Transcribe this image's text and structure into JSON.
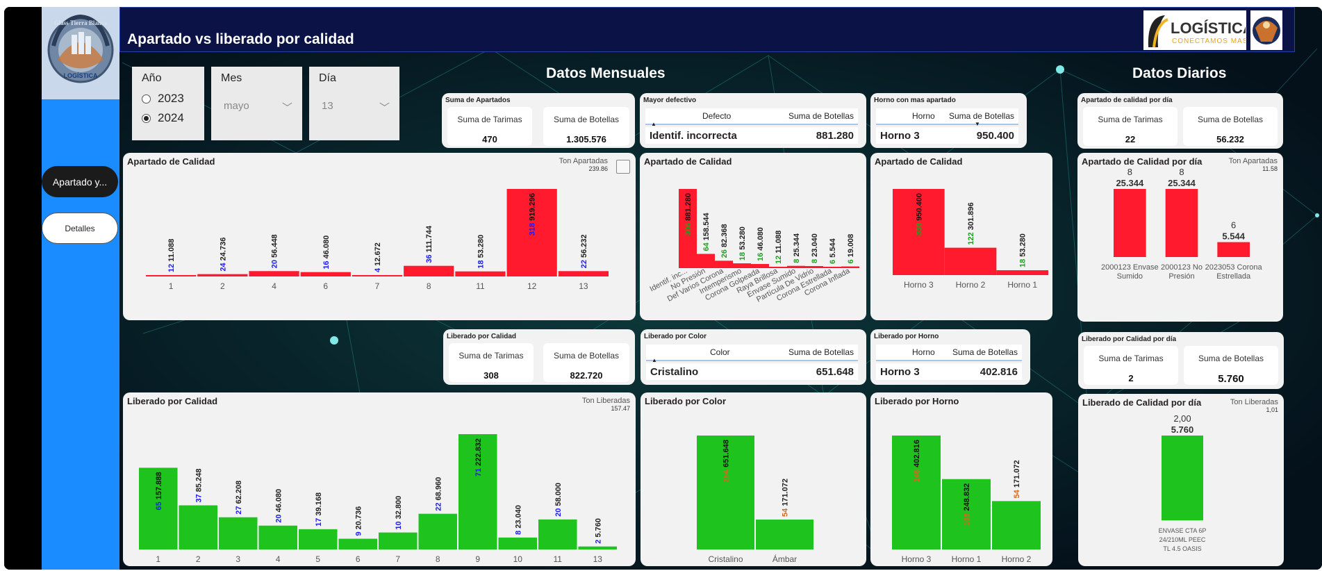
{
  "nav": {
    "logo_text": "Glass Tierra Blanca",
    "logo_sub": "LOGÍSTICA",
    "btn_active": "Apartado y...",
    "btn_detalles": "Detalles"
  },
  "header": {
    "title": "Apartado vs liberado por calidad",
    "logo_main": "LOGÍSTICA",
    "logo_tag": "CONECTAMOS MAS"
  },
  "sections": {
    "monthly": "Datos Mensuales",
    "daily": "Datos Diarios"
  },
  "filters": {
    "year_label": "Año",
    "years": [
      {
        "label": "2023",
        "selected": false
      },
      {
        "label": "2024",
        "selected": true
      }
    ],
    "month_label": "Mes",
    "month_value": "mayo",
    "day_label": "Día",
    "day_value": "13"
  },
  "kpi": {
    "sum_apartados": {
      "title": "Suma de Apartados",
      "l1": "Suma de Tarimas",
      "v1": "470",
      "l2": "Suma de Botellas",
      "v2": "1.305.576"
    },
    "liberado_calidad": {
      "title": "Liberado por Calidad",
      "l1": "Suma de Tarimas",
      "v1": "308",
      "l2": "Suma de Botellas",
      "v2": "822.720"
    },
    "apartado_dia": {
      "title": "Apartado de calidad por día",
      "l1": "Suma de Tarimas",
      "v1": "22",
      "l2": "Suma de Botellas",
      "v2": "56.232"
    },
    "liberado_dia": {
      "title": "Liberado por Calidad por día",
      "l1": "Suma de Tarimas",
      "v1": "2",
      "l2": "Suma de Botellas",
      "v2": "5.760"
    }
  },
  "tables": {
    "mayor_defectivo": {
      "title": "Mayor defectivo",
      "c1": "Defecto",
      "c2": "Suma de Botellas",
      "r1": "Identif. incorrecta",
      "r2": "881.280"
    },
    "horno_apartado": {
      "title": "Horno con mas apartado",
      "c1": "Horno",
      "c2": "Suma de Botellas",
      "r1": "Horno 3",
      "r2": "950.400"
    },
    "liberado_color": {
      "title": "Liberado por Color",
      "c1": "Color",
      "c2": "Suma de Botellas",
      "r1": "Cristalino",
      "r2": "651.648"
    },
    "liberado_horno": {
      "title": "Liberado por Horno",
      "c1": "Horno",
      "c2": "Suma de Botellas",
      "r1": "Horno 3",
      "r2": "402.816"
    }
  },
  "chart_titles": {
    "c1": "Apartado de Calidad",
    "c1_legend": "Ton Apartadas",
    "c1_legend_val": "239.86",
    "c2": "Apartado de Calidad",
    "c3": "Apartado de Calidad",
    "c4": "Apartado de Calidad por día",
    "c4_legend": "Ton Apartadas",
    "c4_legend_val": "11.58",
    "c5": "Liberado por Calidad",
    "c5_legend": "Ton Liberadas",
    "c5_legend_val": "157.47",
    "c6": "Liberado por Color",
    "c7": "Liberado por Horno",
    "c8": "Liberado de Calidad por día",
    "c8_legend": "Ton Liberadas",
    "c8_legend_val": "1,01"
  },
  "chart_data": [
    {
      "id": "apartado_dia_mes",
      "type": "bar",
      "color": "#ff1a2e",
      "categories": [
        "1",
        "2",
        "4",
        "6",
        "7",
        "8",
        "11",
        "12",
        "13"
      ],
      "values": [
        11088,
        24736,
        56448,
        46080,
        12672,
        111744,
        53280,
        919296,
        56232
      ],
      "labels": [
        "11.088",
        "24.736",
        "56.448",
        "46.080",
        "12.672",
        "111.744",
        "53.280",
        "919.296",
        "56.232"
      ],
      "counts": [
        "12",
        "24",
        "20",
        "16",
        "4",
        "36",
        "18",
        "318",
        "22"
      ],
      "count_color": "#1a1aff"
    },
    {
      "id": "apartado_defecto",
      "type": "bar",
      "color": "#ff1a2e",
      "categories": [
        "Identif. inc...",
        "No Presión",
        "Def Varios Corona",
        "Intemperismo",
        "Corona Golpeada",
        "Raya Brillosa",
        "Envase Sumido",
        "Partícula De Vidrio",
        "Corona Estrellada",
        "Corona Inflada"
      ],
      "values": [
        881280,
        158544,
        82368,
        53280,
        46080,
        11088,
        25344,
        23040,
        5544,
        19008
      ],
      "labels": [
        "881.280",
        "158.544",
        "82.368",
        "53.280",
        "46.080",
        "11.088",
        "25.344",
        "23.040",
        "5.544",
        "19.008"
      ],
      "counts": [
        "306",
        "64",
        "26",
        "18",
        "16",
        "12",
        "8",
        "8",
        "6",
        "6"
      ],
      "count_color": "#1aa31a"
    },
    {
      "id": "apartado_horno",
      "type": "bar",
      "color": "#ff1a2e",
      "categories": [
        "Horno 3",
        "Horno 2",
        "Horno 1"
      ],
      "values": [
        950400,
        301896,
        53280
      ],
      "labels": [
        "950.400",
        "301.896",
        "53.280"
      ],
      "counts": [
        "338",
        "122",
        "18"
      ],
      "count_color": "#1aa31a"
    },
    {
      "id": "apartado_por_dia",
      "type": "bar",
      "color": "#ff1a2e",
      "categories": [
        "2000123 Envase Sumido",
        "2000123 No Presión",
        "2023053 Corona Estrellada"
      ],
      "values": [
        25344,
        25344,
        5544
      ],
      "labels": [
        "25.344",
        "25.344",
        "5.544"
      ],
      "counts": [
        "8",
        "8",
        "6"
      ]
    },
    {
      "id": "liberado_dia_mes",
      "type": "bar",
      "color": "#1ec31e",
      "categories": [
        "1",
        "2",
        "3",
        "4",
        "5",
        "6",
        "7",
        "8",
        "9",
        "10",
        "11",
        "13"
      ],
      "values": [
        157888,
        85248,
        62208,
        46080,
        39168,
        20736,
        32800,
        68960,
        222832,
        23040,
        58000,
        5760
      ],
      "labels": [
        "157.888",
        "85.248",
        "62.208",
        "46.080",
        "39.168",
        "20.736",
        "32.800",
        "68.960",
        "222.832",
        "23.040",
        "58.000",
        "5.760"
      ],
      "counts": [
        "65",
        "37",
        "27",
        "20",
        "17",
        "9",
        "10",
        "22",
        "71",
        "8",
        "20",
        "2"
      ],
      "count_color": "#1a1aff"
    },
    {
      "id": "liberado_color",
      "type": "bar",
      "color": "#1ec31e",
      "categories": [
        "Cristalino",
        "Ámbar"
      ],
      "values": [
        651648,
        171072
      ],
      "labels": [
        "651.648",
        "171.072"
      ],
      "counts": [
        "254",
        "54"
      ],
      "count_color": "#d2691e"
    },
    {
      "id": "liberado_horno",
      "type": "bar",
      "color": "#1ec31e",
      "categories": [
        "Horno 3",
        "Horno 1",
        "Horno 2"
      ],
      "values": [
        402816,
        248832,
        171072
      ],
      "labels": [
        "402.816",
        "248.832",
        "171.072"
      ],
      "counts": [
        "146",
        "108",
        "54"
      ],
      "count_color": "#d2691e"
    },
    {
      "id": "liberado_por_dia",
      "type": "bar",
      "color": "#1ec31e",
      "categories": [
        "ENVASE CTA 6P 24/210ML PEEC TL 4.5 OASIS"
      ],
      "values": [
        5760
      ],
      "labels": [
        "5.760"
      ],
      "counts": [
        "2,00"
      ]
    }
  ]
}
